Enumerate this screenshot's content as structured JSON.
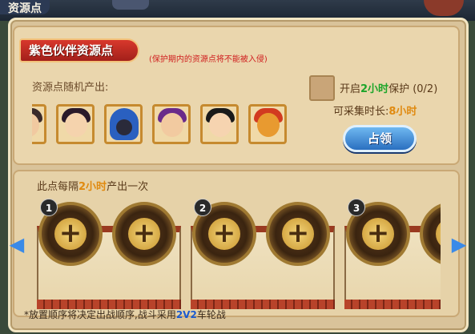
{
  "top": {
    "title": "资源点"
  },
  "header": {
    "title": "紫色伙伴资源点",
    "protect_note": "(保护期内的资源点将不能被入侵)"
  },
  "resources": {
    "label": "资源点随机产出:",
    "portraits": [
      {
        "icon": "partial-hero-portrait-icon",
        "hair": "#3a2a2a",
        "face": "#f1c9a0"
      },
      {
        "icon": "hero-portrait-icon",
        "hair": "#2a1a2a",
        "face": "#f5d3ad"
      },
      {
        "icon": "hooded-hero-portrait-icon",
        "hair": "#2a60c0",
        "face": "#2a2a3a"
      },
      {
        "icon": "hero-portrait-icon",
        "hair": "#6a2a8a",
        "face": "#f2caa0"
      },
      {
        "icon": "hero-portrait-icon",
        "hair": "#1a1a1a",
        "face": "#f6d4b0"
      },
      {
        "icon": "dragon-portrait-icon",
        "hair": "#d23a20",
        "face": "#e89a30"
      }
    ]
  },
  "protect": {
    "prefix": "开启",
    "hours": "2小时",
    "suffix": "保护 (0/2)"
  },
  "collect": {
    "label": "可采集时长:",
    "value": "8小时"
  },
  "occupy_button": "占领",
  "production": {
    "prefix": "此点每隔",
    "hours": "2小时",
    "suffix": "产出一次"
  },
  "slots": {
    "groups": [
      {
        "number": "1"
      },
      {
        "number": "2"
      },
      {
        "number": "3"
      }
    ],
    "plus": "+"
  },
  "arrows": {
    "left": "◀",
    "right": "▶"
  },
  "footer": {
    "prefix": "*放置顺序将决定出战顺序,战斗采用",
    "mode": "2V2",
    "suffix": "车轮战"
  },
  "colors": {
    "banner": "#c72b22",
    "accent_green": "#1da52a",
    "accent_orange": "#e08a10",
    "button_blue": "#3a86d6"
  }
}
